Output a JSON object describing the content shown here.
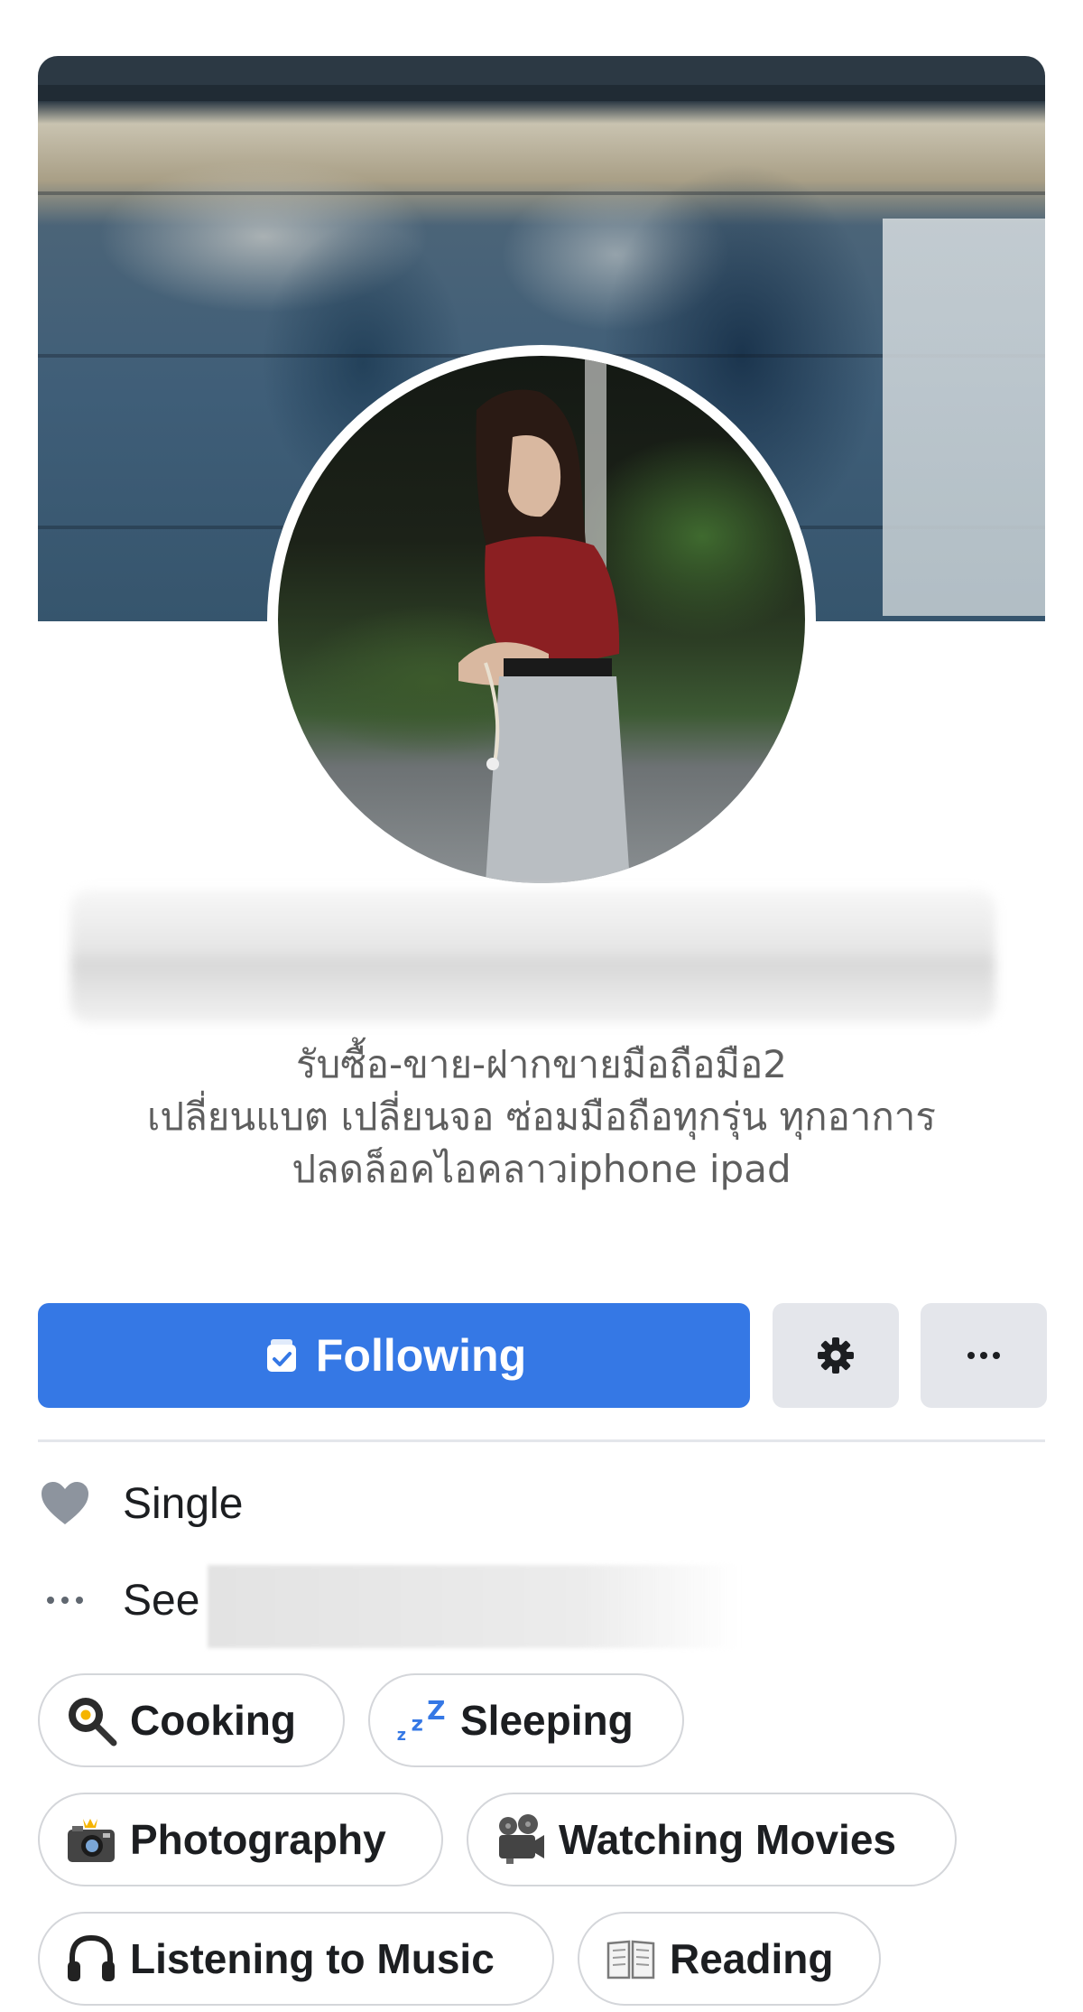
{
  "profile": {
    "bio_lines": [
      "รับซื้อ-ขาย-ฝากขายมือถือมือ2",
      "เปลี่ยนแบต เปลี่ยนจอ ซ่อมมือถือทุกรุ่น ทุกอาการ",
      "ปลดล็อคไอคลาวiphone ipad"
    ]
  },
  "actions": {
    "following_label": "Following",
    "settings_icon": "gear-icon",
    "more_icon": "more-dots-icon",
    "accent_color": "#3578e5"
  },
  "details": {
    "relationship": "Single",
    "see_more": "See"
  },
  "interests": [
    {
      "label": "Cooking",
      "icon": "cooking-icon"
    },
    {
      "label": "Sleeping",
      "icon": "sleeping-icon"
    },
    {
      "label": "Photography",
      "icon": "camera-icon"
    },
    {
      "label": "Watching Movies",
      "icon": "movie-camera-icon"
    },
    {
      "label": "Listening to Music",
      "icon": "headphones-icon"
    },
    {
      "label": "Reading",
      "icon": "book-icon"
    }
  ]
}
